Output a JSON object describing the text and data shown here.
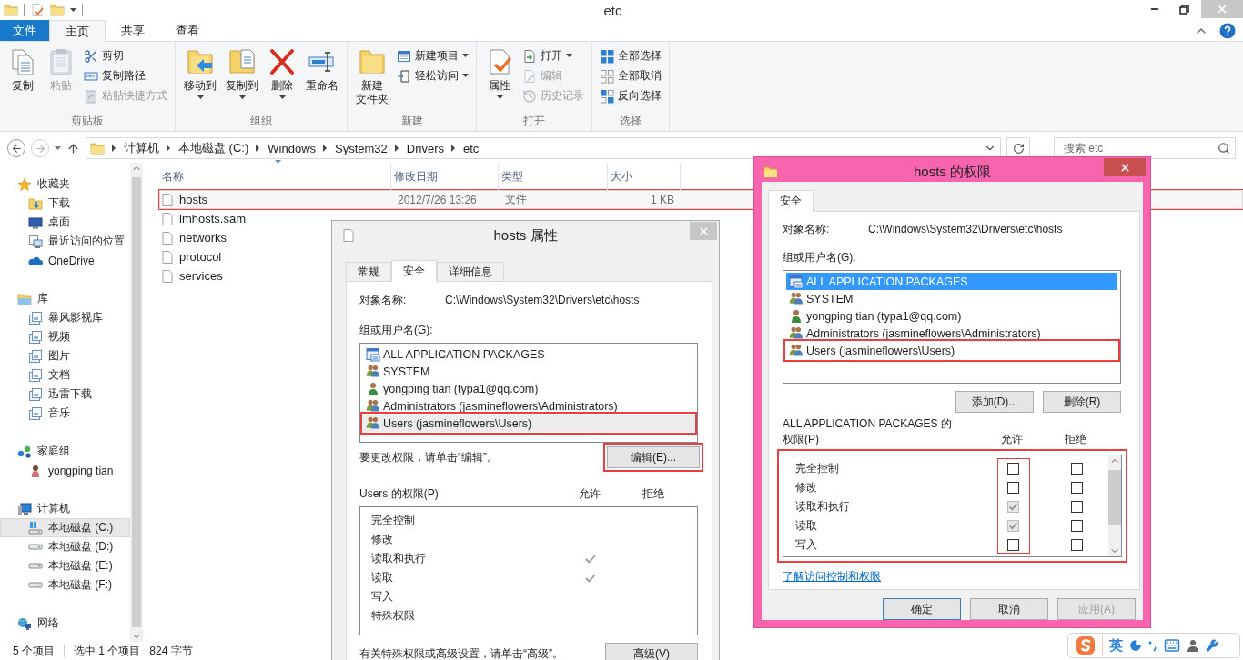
{
  "window": {
    "title": "etc"
  },
  "ribbon_tabs": [
    {
      "label": "文件",
      "kind": "menu",
      "selected": false
    },
    {
      "label": "主页",
      "kind": "tab",
      "selected": true
    },
    {
      "label": "共享",
      "kind": "tab",
      "selected": false
    },
    {
      "label": "查看",
      "kind": "tab",
      "selected": false
    }
  ],
  "ribbon_groups": [
    {
      "label": "剪贴板",
      "commands": [
        {
          "label": "复制",
          "kind": "large",
          "disabled": false,
          "dropdown": false
        },
        {
          "label": "粘贴",
          "kind": "large",
          "disabled": true,
          "dropdown": false
        },
        {
          "label": "剪切",
          "kind": "small",
          "disabled": false,
          "dropdown": false
        },
        {
          "label": "复制路径",
          "kind": "small",
          "disabled": false,
          "dropdown": false
        },
        {
          "label": "粘贴快捷方式",
          "kind": "small",
          "disabled": true,
          "dropdown": false
        }
      ]
    },
    {
      "label": "组织",
      "commands": [
        {
          "label": "移动到",
          "kind": "large",
          "disabled": false,
          "dropdown": true
        },
        {
          "label": "复制到",
          "kind": "large",
          "disabled": false,
          "dropdown": true
        },
        {
          "label": "删除",
          "kind": "large",
          "disabled": false,
          "dropdown": true
        },
        {
          "label": "重命名",
          "kind": "large",
          "disabled": false,
          "dropdown": false
        }
      ]
    },
    {
      "label": "新建",
      "commands": [
        {
          "label": [
            "新建",
            "文件夹"
          ],
          "kind": "large",
          "disabled": false,
          "dropdown": false
        },
        {
          "label": "新建项目",
          "kind": "small",
          "disabled": false,
          "dropdown": true
        },
        {
          "label": "轻松访问",
          "kind": "small",
          "disabled": false,
          "dropdown": true
        }
      ]
    },
    {
      "label": "打开",
      "commands": [
        {
          "label": "属性",
          "kind": "large",
          "disabled": false,
          "dropdown": true
        },
        {
          "label": "打开",
          "kind": "small",
          "disabled": false,
          "dropdown": true
        },
        {
          "label": "编辑",
          "kind": "small",
          "disabled": true,
          "dropdown": false
        },
        {
          "label": "历史记录",
          "kind": "small",
          "disabled": true,
          "dropdown": false
        }
      ]
    },
    {
      "label": "选择",
      "commands": [
        {
          "label": "全部选择",
          "kind": "small",
          "disabled": false,
          "dropdown": false
        },
        {
          "label": "全部取消",
          "kind": "small",
          "disabled": false,
          "dropdown": false
        },
        {
          "label": "反向选择",
          "kind": "small",
          "disabled": false,
          "dropdown": false
        }
      ]
    }
  ],
  "address": {
    "path": [
      "计算机",
      "本地磁盘 (C:)",
      "Windows",
      "System32",
      "Drivers",
      "etc"
    ],
    "search": {
      "placeholder": "搜索 etc"
    }
  },
  "navigation": [
    {
      "label": "收藏夹",
      "kind": "favorites",
      "selected": false,
      "children": [
        {
          "label": "下载",
          "kind": "downloads",
          "selected": false
        },
        {
          "label": "桌面",
          "kind": "desktop",
          "selected": false
        },
        {
          "label": "最近访问的位置",
          "kind": "recent",
          "selected": false
        },
        {
          "label": "OneDrive",
          "kind": "cloud",
          "selected": false
        }
      ]
    },
    {
      "label": "库",
      "kind": "libraries",
      "selected": false,
      "children": [
        {
          "label": "暴风影视库",
          "kind": "library",
          "selected": false
        },
        {
          "label": "视频",
          "kind": "library",
          "selected": false
        },
        {
          "label": "图片",
          "kind": "library",
          "selected": false
        },
        {
          "label": "文档",
          "kind": "library",
          "selected": false
        },
        {
          "label": "迅雷下载",
          "kind": "library",
          "selected": false
        },
        {
          "label": "音乐",
          "kind": "library",
          "selected": false
        }
      ]
    },
    {
      "label": "家庭组",
      "kind": "homegroup",
      "selected": false,
      "children": [
        {
          "label": "yongping tian",
          "kind": "person",
          "selected": false
        }
      ]
    },
    {
      "label": "计算机",
      "kind": "computer",
      "selected": false,
      "children": [
        {
          "label": "本地磁盘 (C:)",
          "kind": "system-drive",
          "selected": true
        },
        {
          "label": "本地磁盘 (D:)",
          "kind": "drive",
          "selected": false
        },
        {
          "label": "本地磁盘 (E:)",
          "kind": "drive",
          "selected": false
        },
        {
          "label": "本地磁盘 (F:)",
          "kind": "drive",
          "selected": false
        }
      ]
    },
    {
      "label": "网络",
      "kind": "network",
      "selected": false
    }
  ],
  "file_list": {
    "columns": [
      {
        "label": "名称",
        "sorted": true
      },
      {
        "label": "修改日期",
        "sorted": false
      },
      {
        "label": "类型",
        "sorted": false
      },
      {
        "label": "大小",
        "sorted": false
      }
    ],
    "rows": [
      {
        "name": "hosts",
        "modified": "2012/7/26 13:26",
        "type": "文件",
        "size": "1 KB",
        "selected": true,
        "highlighted": true
      },
      {
        "name": "lmhosts.sam",
        "selected": false,
        "highlighted": false
      },
      {
        "name": "networks",
        "selected": false,
        "highlighted": false
      },
      {
        "name": "protocol",
        "selected": false,
        "highlighted": false
      },
      {
        "name": "services",
        "selected": false,
        "highlighted": false
      }
    ]
  },
  "status_bar": [
    "5 个项目",
    "选中 1 个项目",
    "824 字节"
  ],
  "properties_dialog": {
    "title": "hosts 属性",
    "tabs": [
      {
        "label": "常规",
        "selected": false
      },
      {
        "label": "安全",
        "selected": true
      },
      {
        "label": "详细信息",
        "selected": false
      }
    ],
    "object_label": "对象名称:",
    "object_name": "C:\\Windows\\System32\\Drivers\\etc\\hosts",
    "groups_label": "组或用户名(G):",
    "principals": [
      {
        "name": "ALL APPLICATION PACKAGES",
        "kind": "package",
        "selected": false,
        "highlighted": false
      },
      {
        "name": "SYSTEM",
        "kind": "group",
        "selected": false,
        "highlighted": false
      },
      {
        "name": "yongping tian (typa1@qq.com)",
        "kind": "user",
        "selected": false,
        "highlighted": false
      },
      {
        "name": "Administrators (jasmineflowers\\Administrators)",
        "kind": "group",
        "selected": false,
        "highlighted": false
      },
      {
        "name": "Users (jasmineflowers\\Users)",
        "kind": "group",
        "selected": true,
        "highlighted": true
      }
    ],
    "edit_hint": "要更改权限，请单击“编辑”。",
    "edit_button": {
      "label": "编辑(E)...",
      "highlighted": true
    },
    "permissions_label": "Users 的权限(P)",
    "allow_label": "允许",
    "deny_label": "拒绝",
    "permissions": [
      {
        "name": "完全控制",
        "allow": false,
        "deny": false
      },
      {
        "name": "修改",
        "allow": false,
        "deny": false
      },
      {
        "name": "读取和执行",
        "allow": true,
        "deny": false
      },
      {
        "name": "读取",
        "allow": true,
        "deny": false
      },
      {
        "name": "写入",
        "allow": false,
        "deny": false
      },
      {
        "name": "特殊权限",
        "allow": false,
        "deny": false
      }
    ],
    "advanced_hint": "有关特殊权限或高级设置，请单击“高级”。",
    "advanced_button": {
      "label": "高级(V)"
    }
  },
  "permissions_dialog": {
    "title": "hosts 的权限",
    "tabs": [
      {
        "label": "安全",
        "selected": true
      }
    ],
    "object_label": "对象名称:",
    "object_name": "C:\\Windows\\System32\\Drivers\\etc\\hosts",
    "groups_label": "组或用户名(G):",
    "principals": [
      {
        "name": "ALL APPLICATION PACKAGES",
        "kind": "package",
        "selected": true,
        "highlighted": false
      },
      {
        "name": "SYSTEM",
        "kind": "group",
        "selected": false,
        "highlighted": false
      },
      {
        "name": "yongping tian (typa1@qq.com)",
        "kind": "user",
        "selected": false,
        "highlighted": false
      },
      {
        "name": "Administrators (jasmineflowers\\Administrators)",
        "kind": "group",
        "selected": false,
        "highlighted": false
      },
      {
        "name": "Users (jasmineflowers\\Users)",
        "kind": "group",
        "selected": false,
        "highlighted": true
      }
    ],
    "add_button": "添加(D)...",
    "remove_button": "删除(R)",
    "permissions_label": "ALL APPLICATION PACKAGES 的权限(P)",
    "allow_label": "允许",
    "deny_label": "拒绝",
    "permissions_highlighted": true,
    "allow_column_highlighted": true,
    "permissions": [
      {
        "name": "完全控制",
        "allow": false,
        "allow_disabled": false,
        "deny": false
      },
      {
        "name": "修改",
        "allow": false,
        "allow_disabled": false,
        "deny": false
      },
      {
        "name": "读取和执行",
        "allow": true,
        "allow_disabled": true,
        "deny": false
      },
      {
        "name": "读取",
        "allow": true,
        "allow_disabled": true,
        "deny": false
      },
      {
        "name": "写入",
        "allow": false,
        "allow_disabled": false,
        "deny": false
      }
    ],
    "help_link": "了解访问控制和权限",
    "buttons": [
      {
        "label": "确定",
        "default": true,
        "disabled": false
      },
      {
        "label": "取消",
        "default": false,
        "disabled": false
      },
      {
        "label": "应用(A)",
        "default": false,
        "disabled": true
      }
    ]
  },
  "ime_bar": {
    "language": "英"
  }
}
